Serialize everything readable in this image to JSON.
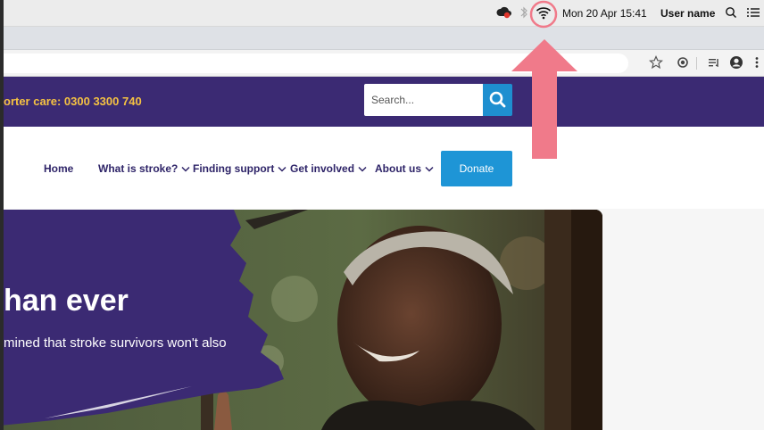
{
  "menubar": {
    "datetime": "Mon 20 Apr  15:41",
    "user": "User name",
    "icons": [
      "creative-cloud-icon",
      "bluetooth-icon",
      "wifi-icon",
      "spotlight-search-icon",
      "menu-list-icon"
    ]
  },
  "browser": {
    "toolbar_icons": [
      "star-icon",
      "extension-icon",
      "reading-list-icon",
      "profile-icon",
      "more-icon"
    ]
  },
  "site": {
    "supporter_care": "orter care: 0300 3300 740",
    "search_placeholder": "Search...",
    "nav": {
      "items": [
        {
          "label": "Home",
          "dropdown": false
        },
        {
          "label": "What is stroke?",
          "dropdown": true
        },
        {
          "label": "Finding support",
          "dropdown": true
        },
        {
          "label": "Get involved",
          "dropdown": true
        },
        {
          "label": "About us",
          "dropdown": true
        }
      ],
      "donate": "Donate"
    },
    "hero": {
      "title": "han ever",
      "subtitle": "mined that stroke survivors won't also"
    },
    "colors": {
      "brand_purple": "#3b2a73",
      "accent_yellow": "#f5c242",
      "accent_blue": "#1e95d6",
      "annotation_pink": "#f07a8a"
    }
  }
}
